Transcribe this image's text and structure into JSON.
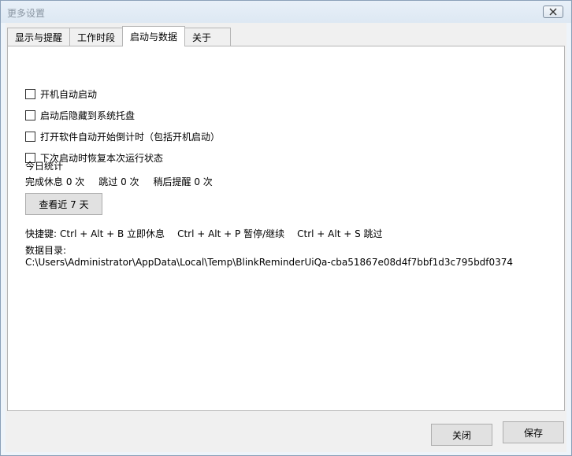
{
  "window": {
    "title": "更多设置",
    "close_label": "✕"
  },
  "tabs": [
    {
      "label": "显示与提醒",
      "active": false
    },
    {
      "label": "工作时段",
      "active": false
    },
    {
      "label": "启动与数据",
      "active": true
    },
    {
      "label": "关于",
      "active": false
    }
  ],
  "startup": {
    "options": [
      {
        "label": "开机自动启动",
        "checked": false
      },
      {
        "label": "启动后隐藏到系统托盘",
        "checked": false
      },
      {
        "label": "打开软件自动开始倒计时（包括开机启动）",
        "checked": false
      },
      {
        "label": "下次启动时恢复本次运行状态",
        "checked": false
      }
    ]
  },
  "stats": {
    "title": "今日统计",
    "completed": "完成休息 0 次",
    "skipped": "跳过 0 次",
    "snoozed": "稍后提醒 0 次",
    "view_button": "查看近 7 天"
  },
  "hotkeys": {
    "label": "快捷键:",
    "break_now": "Ctrl + Alt + B 立即休息",
    "pause": "Ctrl + Alt + P 暂停/继续",
    "skip": "Ctrl + Alt + S 跳过"
  },
  "data_dir": {
    "label": "数据目录:",
    "path": "C:\\Users\\Administrator\\AppData\\Local\\Temp\\BlinkReminderUiQa-cba51867e08d4f7bbf1d3c795bdf0374"
  },
  "footer": {
    "close_button": "关闭",
    "save_button": "保存"
  }
}
